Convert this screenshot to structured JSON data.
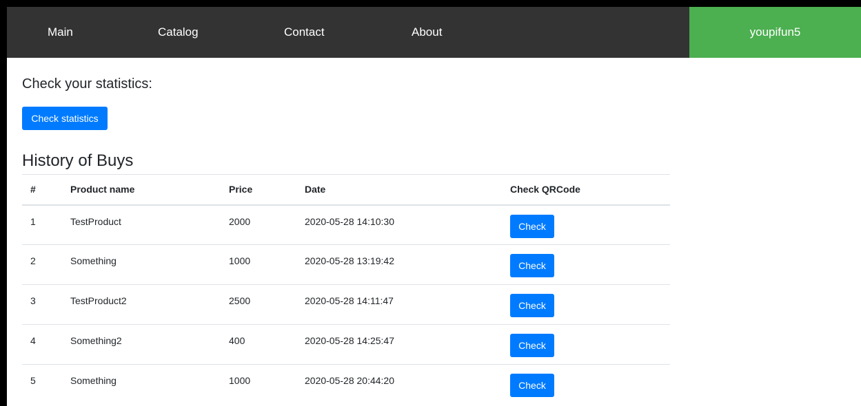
{
  "nav": {
    "items": [
      {
        "label": "Main"
      },
      {
        "label": "Catalog"
      },
      {
        "label": "Contact"
      },
      {
        "label": "About"
      }
    ],
    "user": "youpifun5"
  },
  "stats": {
    "heading": "Check your statistics:",
    "button_label": "Check statistics"
  },
  "history": {
    "heading": "History of Buys",
    "columns": [
      "#",
      "Product name",
      "Price",
      "Date",
      "Check QRCode"
    ],
    "rows": [
      {
        "num": "1",
        "name": "TestProduct",
        "price": "2000",
        "date": "2020-05-28 14:10:30",
        "action": "Check"
      },
      {
        "num": "2",
        "name": "Something",
        "price": "1000",
        "date": "2020-05-28 13:19:42",
        "action": "Check"
      },
      {
        "num": "3",
        "name": "TestProduct2",
        "price": "2500",
        "date": "2020-05-28 14:11:47",
        "action": "Check"
      },
      {
        "num": "4",
        "name": "Something2",
        "price": "400",
        "date": "2020-05-28 14:25:47",
        "action": "Check"
      },
      {
        "num": "5",
        "name": "Something",
        "price": "1000",
        "date": "2020-05-28 20:44:20",
        "action": "Check"
      }
    ]
  },
  "colors": {
    "navbar": "#333333",
    "user_badge": "#4CAF50",
    "primary": "#007bff"
  }
}
